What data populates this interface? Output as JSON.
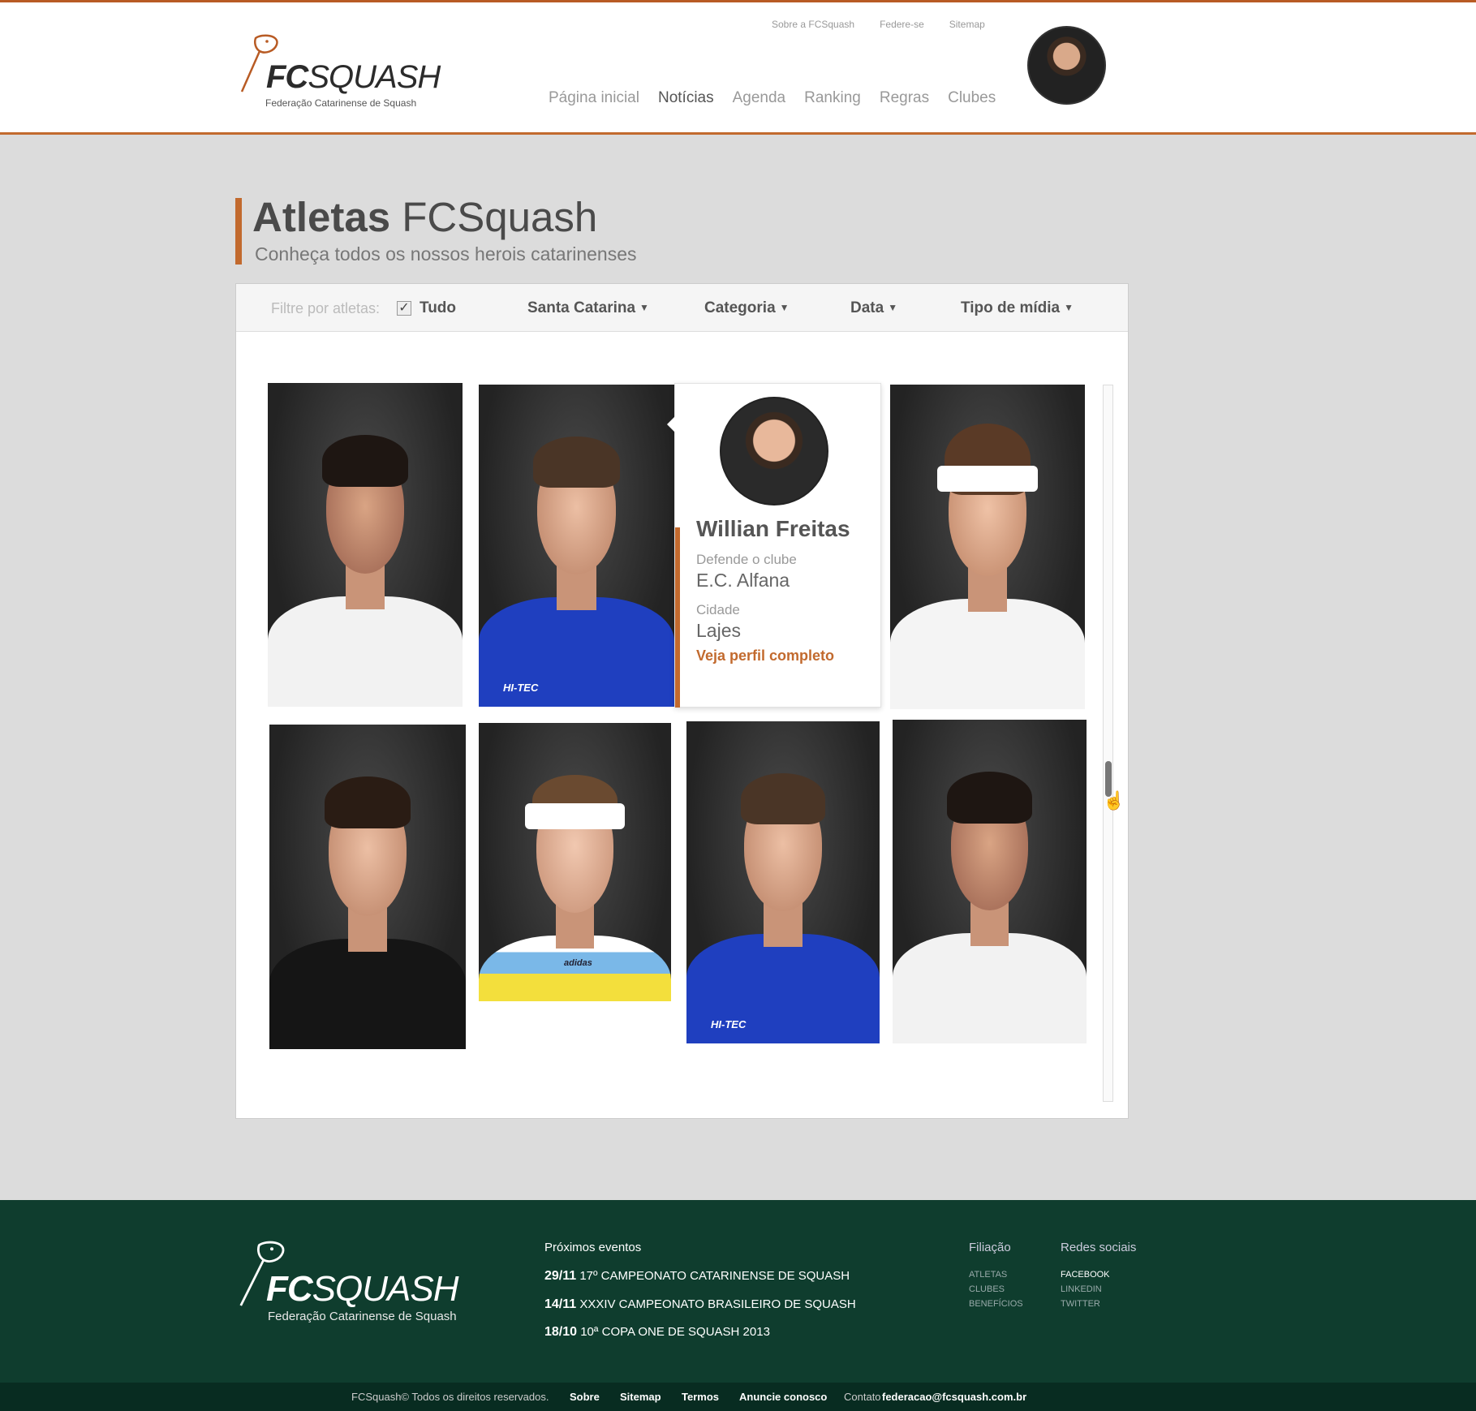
{
  "brand": {
    "name_bold": "FC",
    "name_light": "SQUASH",
    "tagline": "Federação Catarinense de Squash"
  },
  "toplinks": [
    "Sobre a FCSquash",
    "Federe-se",
    "Sitemap"
  ],
  "nav": [
    "Página inicial",
    "Notícias",
    "Agenda",
    "Ranking",
    "Regras",
    "Clubes"
  ],
  "page": {
    "title_bold": "Atletas",
    "title_light": "FCSquash",
    "subtitle": "Conheça todos os nossos herois catarinenses"
  },
  "filters": {
    "label": "Filtre por atletas:",
    "all": "Tudo",
    "state": "Santa Catarina",
    "category": "Categoria",
    "date": "Data",
    "media": "Tipo de mídia"
  },
  "popup": {
    "name": "Willian Freitas",
    "club_label": "Defende o clube",
    "club": "E.C. Alfana",
    "city_label": "Cidade",
    "city": "Lajes",
    "link": "Veja perfil completo"
  },
  "photo_brands": {
    "hitec": "HI-TEC",
    "adidas": "adidas"
  },
  "footer": {
    "events_title": "Próximos eventos",
    "events": [
      {
        "date": "29/11",
        "name": "17º CAMPEONATO CATARINENSE DE SQUASH"
      },
      {
        "date": "14/11",
        "name": "XXXIV CAMPEONATO BRASILEIRO DE SQUASH"
      },
      {
        "date": "18/10",
        "name": "10ª COPA ONE DE SQUASH 2013"
      }
    ],
    "affiliation_title": "Filiação",
    "affiliation": [
      "ATLETAS",
      "CLUBES",
      "BENEFÍCIOS"
    ],
    "social_title": "Redes sociais",
    "social": [
      "FACEBOOK",
      "LINKEDIN",
      "TWITTER"
    ]
  },
  "bottom": {
    "copyright": "FCSquash©  Todos os direitos reservados.",
    "links": [
      "Sobre",
      "Sitemap",
      "Termos",
      "Anuncie conosco"
    ],
    "contact_label": "Contato",
    "contact_email": "federacao@fcsquash.com.br"
  },
  "colors": {
    "accent": "#c26a2e",
    "footer_bg": "#0f3d2e",
    "page_bg": "#dcdcdc"
  }
}
